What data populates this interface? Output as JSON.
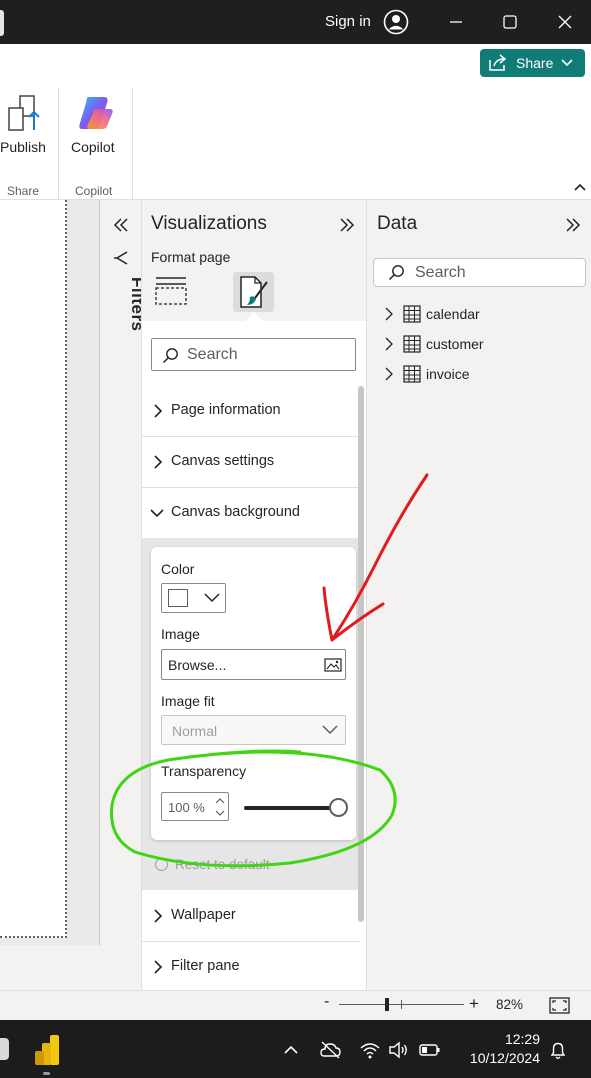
{
  "titlebar": {
    "signin": "Sign in"
  },
  "ribbon": {
    "share_label": "Share",
    "publish_label": "Publish",
    "share_group": "Share",
    "copilot_label": "Copilot",
    "copilot_group": "Copilot"
  },
  "filters": {
    "label": "Filters"
  },
  "visualizations": {
    "title": "Visualizations",
    "subtitle": "Format page",
    "search_placeholder": "Search",
    "sections": [
      "Page information",
      "Canvas settings",
      "Canvas background",
      "Wallpaper",
      "Filter pane"
    ],
    "canvas_background": {
      "color_label": "Color",
      "color_value": "#ffffff",
      "image_label": "Image",
      "image_button": "Browse...",
      "image_fit_label": "Image fit",
      "image_fit_value": "Normal",
      "transparency_label": "Transparency",
      "transparency_value": "100 %",
      "transparency_percent": 100,
      "reset": "Reset to default"
    }
  },
  "data_pane": {
    "title": "Data",
    "search_placeholder": "Search",
    "tables": [
      "calendar",
      "customer",
      "invoice"
    ]
  },
  "statusbar": {
    "zoom_level": "82%",
    "zoom_minus": "-",
    "zoom_plus": "+"
  },
  "taskbar": {
    "time": "12:29",
    "date": "10/12/2024"
  },
  "colors": {
    "accent": "#107c78",
    "annotation_red": "#e01b1b",
    "annotation_green": "#3ed614"
  }
}
